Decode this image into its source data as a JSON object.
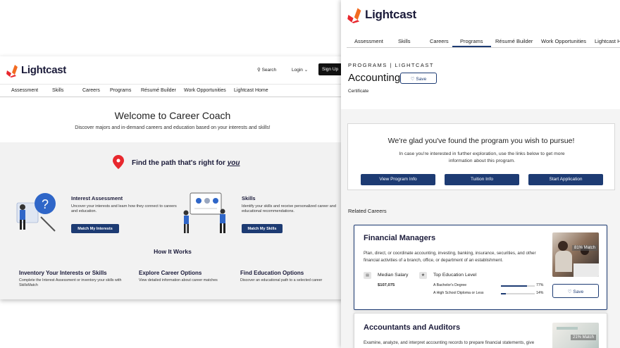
{
  "brand": {
    "name": "Lightcast",
    "colors": {
      "red": "#e8282e",
      "orange": "#f26b21",
      "navy": "#1d3b73"
    }
  },
  "left": {
    "header": {
      "search_label": "Search",
      "login_label": "Login",
      "signup_label": "Sign Up"
    },
    "nav": [
      "Assessment",
      "Skills",
      "Careers",
      "Programs",
      "Résumé Builder",
      "Work Opportunities",
      "Lightcast Home"
    ],
    "hero": {
      "title": "Welcome to Career Coach",
      "subtitle": "Discover majors and in-demand careers and education based on your interests and skills!"
    },
    "path": {
      "title": "Find the path that's right for ",
      "title_emphasis": "you"
    },
    "interest": {
      "title": "Interest Assessment",
      "desc": "Uncover your interests and learn how they connect to careers and education.",
      "button": "Match My Interests"
    },
    "skills": {
      "title": "Skills",
      "desc": "Identify your skills and receive personalized career and educational recommendations.",
      "button": "Match My Skills"
    },
    "how": {
      "title": "How It Works",
      "items": [
        {
          "title": "Inventory Your Interests or Skills",
          "desc": "Complete the Interest Assessment or inventory your skills with SkillsMatch"
        },
        {
          "title": "Explore Career Options",
          "desc": "View detailed information about career matches"
        },
        {
          "title": "Find Education Options",
          "desc": "Discover an educational path to a selected career"
        }
      ]
    }
  },
  "right": {
    "nav": [
      "Assessment",
      "Skills",
      "Careers",
      "Programs",
      "Résumé Builder",
      "Work Opportunities",
      "Lightcast H"
    ],
    "active_nav": "Programs",
    "eyebrow": "PROGRAMS | LIGHTCAST",
    "program_title": "Accounting",
    "save_label": "Save",
    "program_type": "Certificate",
    "glad": {
      "title": "We're glad you've found the program you wish to pursue!",
      "text": "In case you're interested in further exploration, use the links below to get more information about this program.",
      "buttons": [
        "View Program Info",
        "Tuition Info",
        "Start Application"
      ]
    },
    "related_label": "Related Careers",
    "careers": [
      {
        "title": "Financial Managers",
        "desc": "Plan, direct, or coordinate accounting, investing, banking, insurance, securities, and other financial activities of a branch, office, or department of an establishment.",
        "salary_label": "Median Salary",
        "salary": "$107,075",
        "edu_label": "Top Education Level",
        "edu": [
          {
            "name": "A Bachelor's Degree",
            "pct_label": "77%",
            "pct": 77
          },
          {
            "name": "A High School Diploma or Less",
            "pct_label": "14%",
            "pct": 14
          }
        ],
        "match": "81% Match",
        "save_label": "Save"
      },
      {
        "title": "Accountants and Auditors",
        "desc": "Examine, analyze, and interpret accounting records to prepare financial statements, give",
        "match": "21% Match"
      }
    ]
  }
}
